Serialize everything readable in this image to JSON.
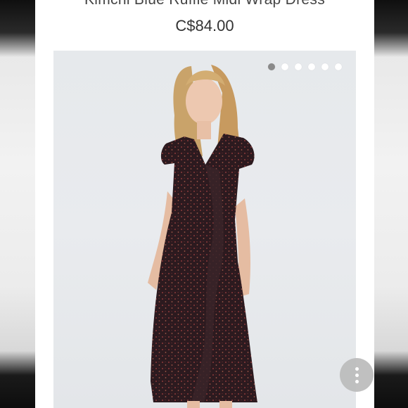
{
  "product": {
    "title": "Kimchi Blue Ruffle Midi Wrap Dress",
    "price": "C$84.00"
  },
  "gallery": {
    "image_count": 6,
    "active_index": 0
  },
  "fab": {
    "icon": "more-vert-icon"
  },
  "colors": {
    "dress": "#2c1a1f",
    "background": "#e8eaed",
    "dot_active": "#8a8a8a",
    "fab": "#bdbdbd"
  }
}
